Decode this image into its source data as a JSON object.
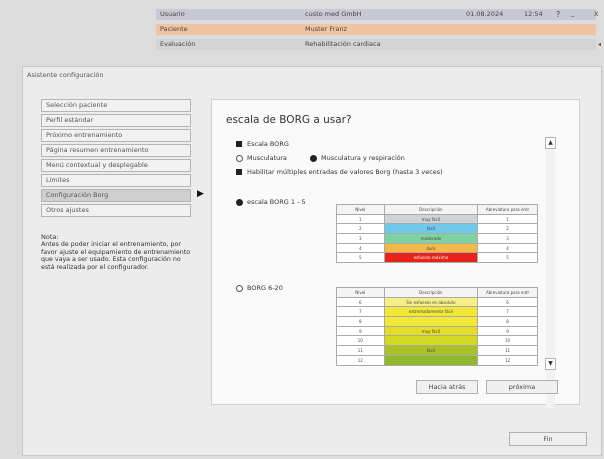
{
  "header": {
    "labels": [
      "Usuario",
      "Paciente",
      "Evaluación"
    ],
    "values": [
      "custo med GmbH",
      "Muster Franz",
      "Rehabilitación cardiaca"
    ],
    "date": "01.08.2024",
    "time": "12:54",
    "help": "?",
    "minimize": "_",
    "close": "X"
  },
  "window": {
    "title": "Asistente configuración"
  },
  "nav": {
    "items": [
      "Selección paciente",
      "Perfil estándar",
      "Próximo entrenamiento",
      "Página resumen entrenamiento",
      "Menú contextual y desplegable",
      "Límites",
      "Configuración Borg",
      "Otros ajustes"
    ],
    "active_index": 6
  },
  "note": {
    "title": "Nota:",
    "text": "Antes de poder iniciar el entrenamiento, por favor ajuste el equipamiento de entrenamiento que vaya a ser usado. Esta configuración no está realizada por el configurador."
  },
  "content": {
    "heading": "escala de BORG a usar?",
    "escala_borg": "Escala BORG",
    "musculatura": "Musculatura",
    "musculatura_resp": "Musculatura y respiración",
    "habilitar": "Habilitar múltiples entradas de valores Borg (hasta 3 veces)",
    "option1": "escala BORG 1 - 5",
    "option2": "BORG 6-20",
    "table_headers": [
      "Nivel",
      "Descripción",
      "Abreviatura para entr"
    ],
    "table1": [
      {
        "nivel": "1",
        "desc": "muy fácil",
        "abbr": "1",
        "color": "#cfd2d6"
      },
      {
        "nivel": "2",
        "desc": "fácil",
        "abbr": "2",
        "color": "#6ec9ea"
      },
      {
        "nivel": "3",
        "desc": "moderado",
        "abbr": "3",
        "color": "#7ed3a0"
      },
      {
        "nivel": "4",
        "desc": "duro",
        "abbr": "4",
        "color": "#f7b84a"
      },
      {
        "nivel": "5",
        "desc": "esfuerzo máximo",
        "abbr": "5",
        "color": "#e8231a"
      }
    ],
    "table2": [
      {
        "nivel": "6",
        "desc": "Sin esfuerzo en absoluto",
        "abbr": "6",
        "color": "#f7f08a"
      },
      {
        "nivel": "7",
        "desc": "extremadamente fácil",
        "abbr": "7",
        "color": "#f2e83a"
      },
      {
        "nivel": "8",
        "desc": "",
        "abbr": "8",
        "color": "#f2e83a"
      },
      {
        "nivel": "9",
        "desc": "muy fácil",
        "abbr": "9",
        "color": "#e4de24"
      },
      {
        "nivel": "10",
        "desc": "",
        "abbr": "10",
        "color": "#d4d820"
      },
      {
        "nivel": "11",
        "desc": "fácil",
        "abbr": "11",
        "color": "#a9c227"
      },
      {
        "nivel": "12",
        "desc": "",
        "abbr": "12",
        "color": "#8fb82a"
      }
    ],
    "btn_back": "Hacia atrás",
    "btn_next": "próxima"
  },
  "footer": {
    "fin": "Fin"
  }
}
